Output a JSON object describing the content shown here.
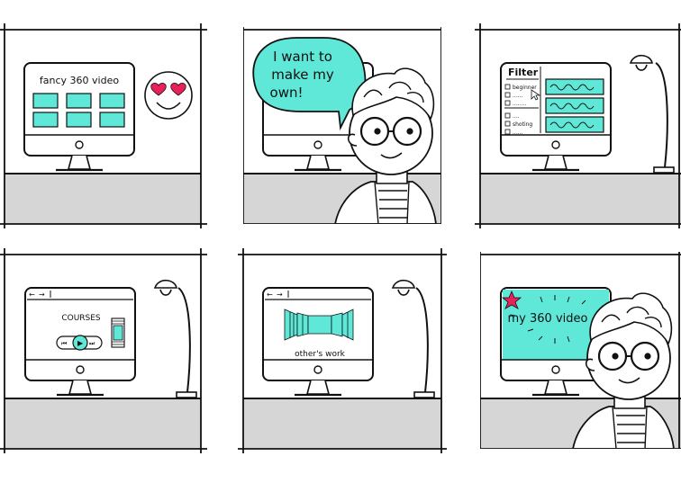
{
  "accent": "#5fe8d8",
  "floor_color": "#d6d6d6",
  "star_color": "#e8215a",
  "heart_color": "#e8215a",
  "panels": [
    {
      "screen_title": "fancy 360  video",
      "icons": [
        "video-thumbnail",
        "heart-eyes-emoji"
      ]
    },
    {
      "speech": [
        "I want to",
        "make my",
        "own!"
      ],
      "icons": [
        "speech-bubble",
        "character-face"
      ]
    },
    {
      "filter_title": "Filter",
      "filter_items": [
        "beginner",
        "......",
        "........",
        "....",
        "shoting",
        "......"
      ],
      "icons": [
        "checkbox-icon",
        "cursor-icon",
        "waveform-thumbnail",
        "desk-lamp"
      ]
    },
    {
      "course_title": "COURSES",
      "icons": [
        "back-arrow-icon",
        "forward-arrow-icon",
        "rewind-icon",
        "play-icon",
        "fast-forward-icon",
        "film-strip-icon",
        "desk-lamp"
      ]
    },
    {
      "gallery_caption": "other's work",
      "icons": [
        "back-arrow-icon",
        "forward-arrow-icon",
        "panorama-strip",
        "desk-lamp"
      ]
    },
    {
      "celebration_text": "my 360 video",
      "icons": [
        "star-icon",
        "character-face"
      ]
    }
  ],
  "nav": {
    "back": "←",
    "forward": "→",
    "rewind": "⏮",
    "play": "▶",
    "fast_forward": "⏭"
  }
}
